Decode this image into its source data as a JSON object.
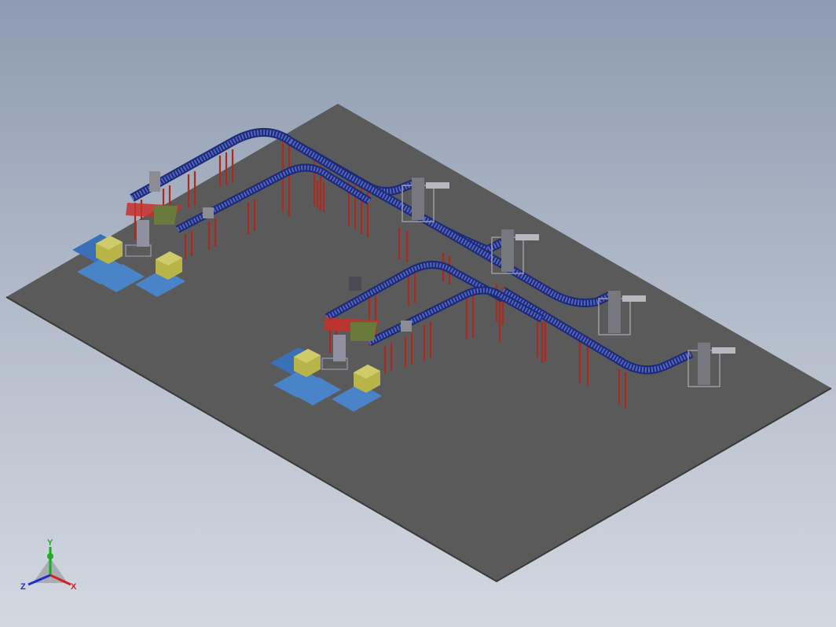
{
  "triad": {
    "x_label": "X",
    "y_label": "Y",
    "z_label": "Z",
    "x_color": "#d42020",
    "y_color": "#18b018",
    "z_color": "#2030d0"
  },
  "colors": {
    "floor": "#5a5a5a",
    "conveyor": "#2a3a9a",
    "support": "#b0281c",
    "pallet_box": "#b8b44a",
    "pallet_frame": "#3a70b8",
    "machine": "#8c8c94"
  },
  "scene": {
    "type": "3d-cad-assembly-view",
    "palletizing_cells": 2,
    "vertical_lifts": 4
  }
}
